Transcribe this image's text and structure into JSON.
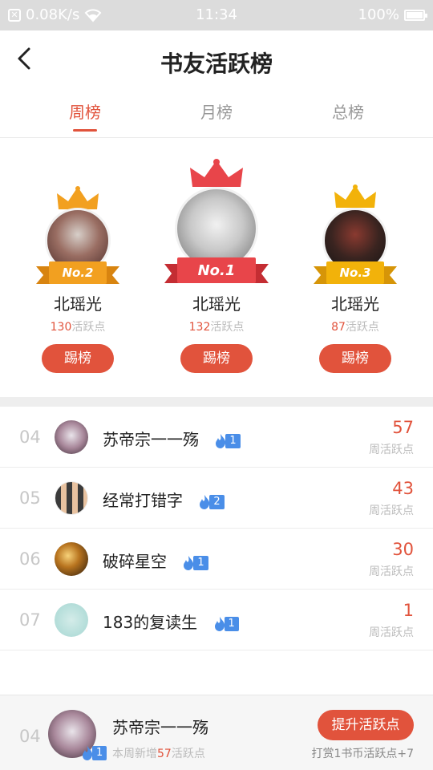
{
  "status_bar": {
    "network_speed": "0.08K/s",
    "time": "11:34",
    "battery": "100%"
  },
  "header": {
    "title": "书友活跃榜"
  },
  "tabs": [
    {
      "label": "周榜",
      "active": true
    },
    {
      "label": "月榜",
      "active": false
    },
    {
      "label": "总榜",
      "active": false
    }
  ],
  "podium": [
    {
      "badge": "No.2",
      "name": "北瑶光",
      "points": "130",
      "points_label": "活跃点",
      "button": "踢榜",
      "color": "#f2a020"
    },
    {
      "badge": "No.1",
      "name": "北瑶光",
      "points": "132",
      "points_label": "活跃点",
      "button": "踢榜",
      "color": "#e8454a"
    },
    {
      "badge": "No.3",
      "name": "北瑶光",
      "points": "87",
      "points_label": "活跃点",
      "button": "踢榜",
      "color": "#f2b20a"
    }
  ],
  "list": [
    {
      "rank": "04",
      "name": "苏帝宗一一殇",
      "fan_level": "1",
      "score": "57",
      "score_label": "周活跃点"
    },
    {
      "rank": "05",
      "name": "经常打错字",
      "fan_level": "2",
      "score": "43",
      "score_label": "周活跃点"
    },
    {
      "rank": "06",
      "name": "破碎星空",
      "fan_level": "1",
      "score": "30",
      "score_label": "周活跃点"
    },
    {
      "rank": "07",
      "name": "183的复读生",
      "fan_level": "1",
      "score": "1",
      "score_label": "周活跃点"
    }
  ],
  "my_rank": {
    "rank": "04",
    "name": "苏帝宗一一殇",
    "fan_level": "1",
    "week_prefix": "本周新增",
    "week_points": "57",
    "week_suffix": "活跃点",
    "button": "提升活跃点",
    "tip": "打赏1书币活跃点+7"
  },
  "colors": {
    "accent": "#e1533c",
    "fan_badge": "#4a8ee8"
  }
}
